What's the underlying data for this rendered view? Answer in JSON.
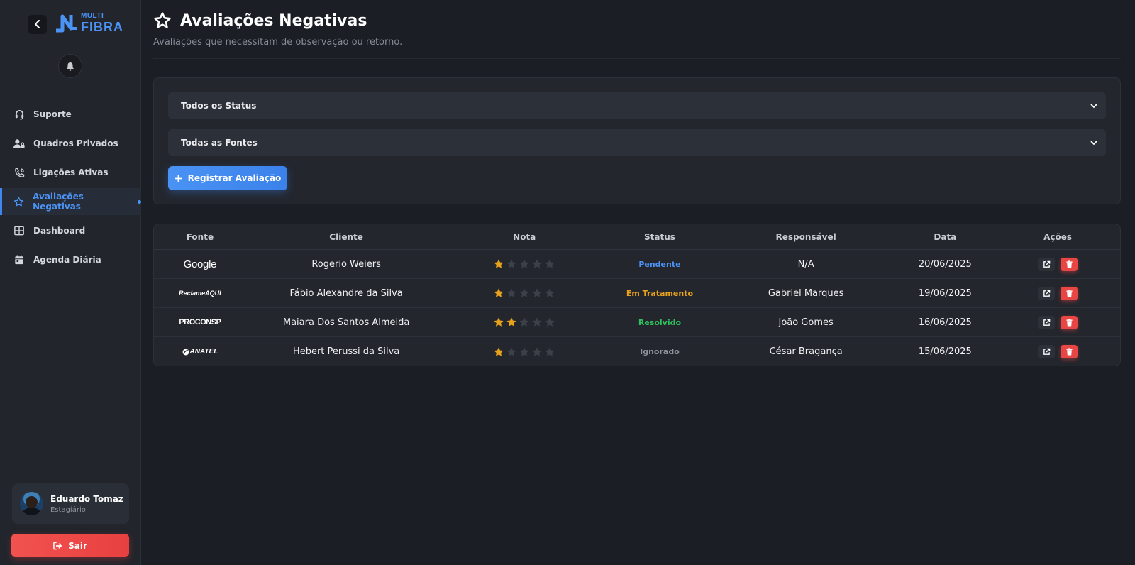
{
  "sidebar": {
    "logo": {
      "line1": "MULTI",
      "line2": "FIBRA"
    },
    "nav": [
      {
        "label": "Suporte",
        "icon": "headset-icon",
        "active": false
      },
      {
        "label": "Quadros Privados",
        "icon": "user-lock-icon",
        "active": false
      },
      {
        "label": "Ligações Ativas",
        "icon": "phone-volume-icon",
        "active": false
      },
      {
        "label": "Avaliações Negativas",
        "icon": "star-icon",
        "active": true
      },
      {
        "label": "Dashboard",
        "icon": "grid-icon",
        "active": false
      },
      {
        "label": "Agenda Diária",
        "icon": "calendar-icon",
        "active": false
      }
    ],
    "user": {
      "name": "Eduardo Tomaz",
      "role": "Estagiário"
    },
    "logout_label": "Sair"
  },
  "header": {
    "title": "Avaliações Negativas",
    "subtitle": "Avaliações que necessitam de observação ou retorno."
  },
  "filters": {
    "status_selected": "Todos os Status",
    "source_selected": "Todas as Fontes",
    "add_button": "Registrar Avaliação"
  },
  "table": {
    "columns": [
      "Fonte",
      "Cliente",
      "Nota",
      "Status",
      "Responsável",
      "Data",
      "Ações"
    ],
    "rows": [
      {
        "source": "Google",
        "client": "Rogerio Weiers",
        "rating": 1,
        "status": "Pendente",
        "status_color": "#4b93f5",
        "responsible": "N/A",
        "date": "20/06/2025"
      },
      {
        "source": "ReclameAQUI",
        "client": "Fábio Alexandre da Silva",
        "rating": 1,
        "status": "Em Tratamento",
        "status_color": "#e8a21c",
        "responsible": "Gabriel Marques",
        "date": "19/06/2025"
      },
      {
        "source": "PROCONSP",
        "client": "Maiara Dos Santos Almeida",
        "rating": 2,
        "status": "Resolvido",
        "status_color": "#2fbf5b",
        "responsible": "João Gomes",
        "date": "16/06/2025"
      },
      {
        "source": "ANATEL",
        "client": "Hebert Perussi da Silva",
        "rating": 1,
        "status": "Ignorado",
        "status_color": "#8d929b",
        "responsible": "César Bragança",
        "date": "15/06/2025"
      }
    ]
  },
  "colors": {
    "accent": "#4b93f5",
    "danger": "#e84545",
    "star_on": "#e8a21c",
    "star_off": "#3c4049"
  }
}
